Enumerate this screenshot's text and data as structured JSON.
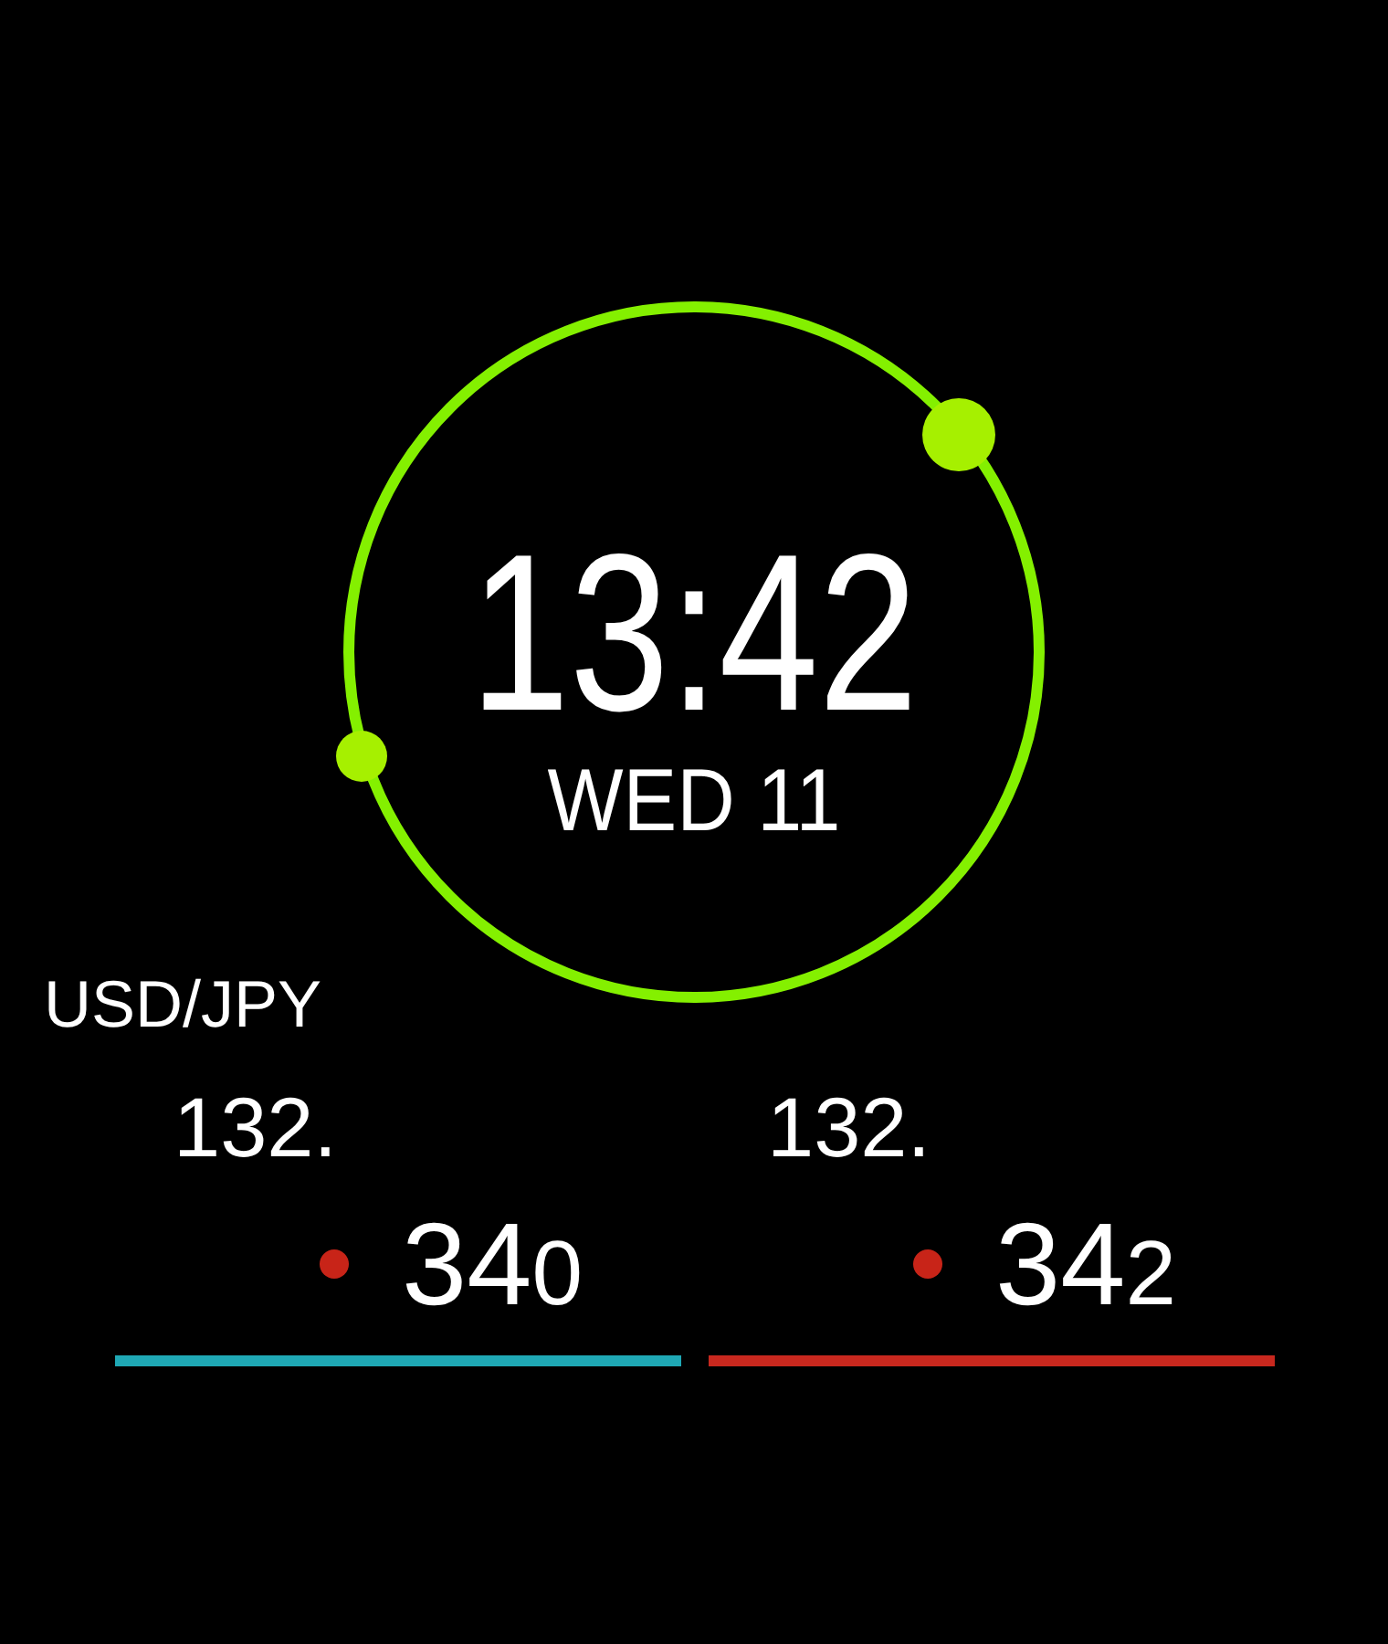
{
  "time": "13:42",
  "date": "WED 11",
  "pair": "USD/JPY",
  "quotes": [
    {
      "prefix": "132.",
      "main": "34",
      "last": "0",
      "color": "#1fa8b5"
    },
    {
      "prefix": "132.",
      "main": "34",
      "last": "2",
      "color": "#c8281e"
    }
  ]
}
